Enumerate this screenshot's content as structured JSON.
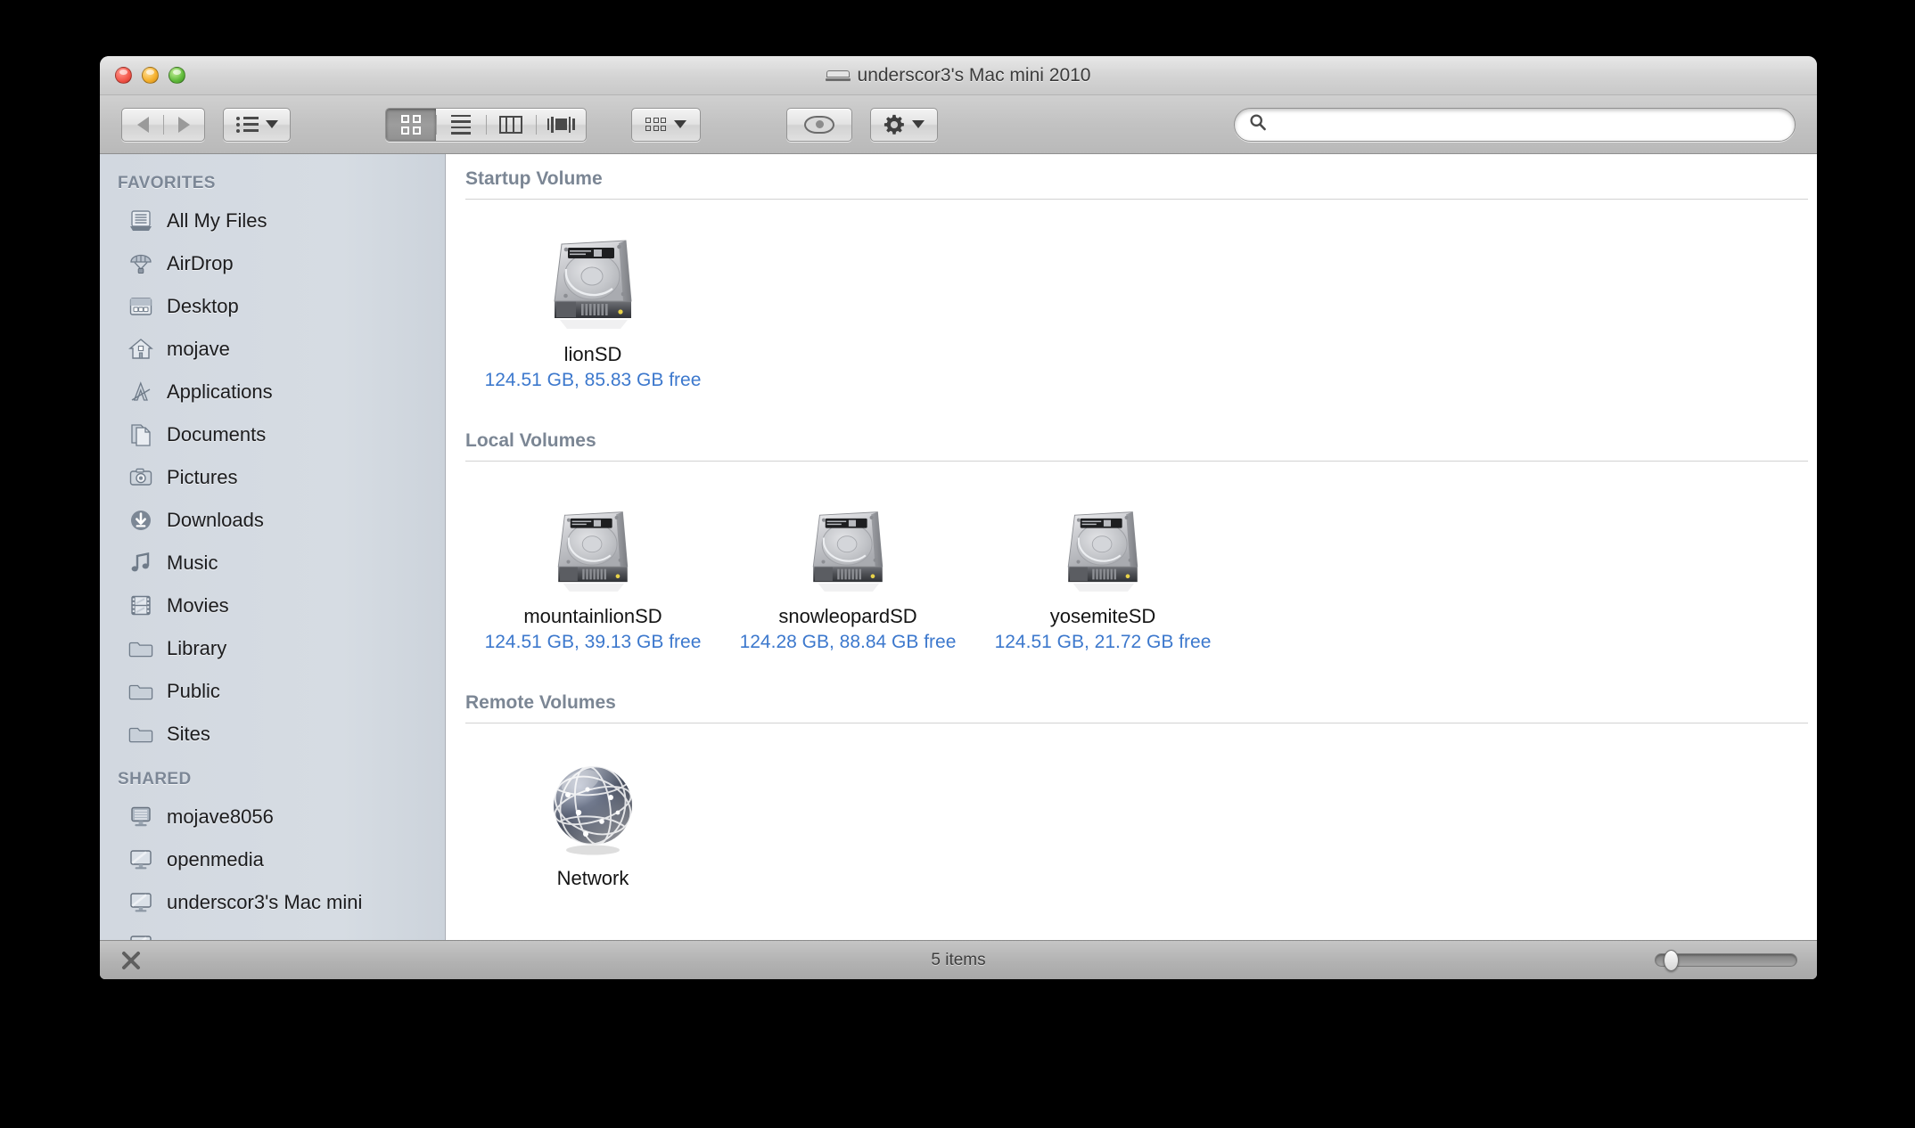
{
  "window": {
    "title": "underscor3's Mac mini 2010",
    "title_icon": "mac-mini-icon"
  },
  "traffic_lights": {
    "close_label": "close",
    "minimize_label": "minimize",
    "zoom_label": "zoom"
  },
  "toolbar": {
    "back_label": "Back",
    "forward_label": "Forward",
    "arrange_label": "Arrange",
    "view_icon_label": "Icon View",
    "view_list_label": "List View",
    "view_column_label": "Column View",
    "view_coverflow_label": "Cover Flow View",
    "view_selected": "Icon View",
    "group_label": "Group By",
    "quicklook_label": "Quick Look",
    "action_label": "Action"
  },
  "search": {
    "value": "",
    "placeholder": "",
    "icon": "search-icon"
  },
  "sidebar": {
    "sections": [
      {
        "header": "FAVORITES",
        "items": [
          {
            "label": "All My Files",
            "icon": "all-my-files-icon"
          },
          {
            "label": "AirDrop",
            "icon": "airdrop-icon"
          },
          {
            "label": "Desktop",
            "icon": "desktop-icon"
          },
          {
            "label": "mojave",
            "icon": "home-icon"
          },
          {
            "label": "Applications",
            "icon": "applications-icon"
          },
          {
            "label": "Documents",
            "icon": "documents-icon"
          },
          {
            "label": "Pictures",
            "icon": "pictures-icon"
          },
          {
            "label": "Downloads",
            "icon": "downloads-icon"
          },
          {
            "label": "Music",
            "icon": "music-icon"
          },
          {
            "label": "Movies",
            "icon": "movies-icon"
          },
          {
            "label": "Library",
            "icon": "folder-icon"
          },
          {
            "label": "Public",
            "icon": "folder-icon"
          },
          {
            "label": "Sites",
            "icon": "folder-icon"
          }
        ]
      },
      {
        "header": "SHARED",
        "items": [
          {
            "label": "mojave8056",
            "icon": "shared-server-icon"
          },
          {
            "label": "openmedia",
            "icon": "shared-display-icon"
          },
          {
            "label": "underscor3's Mac mini",
            "icon": "shared-display-icon"
          }
        ]
      }
    ]
  },
  "content": {
    "groups": [
      {
        "header": "Startup Volume",
        "items": [
          {
            "name": "lionSD",
            "subtitle": "124.51 GB, 85.83 GB free",
            "icon": "hard-drive-icon"
          }
        ]
      },
      {
        "header": "Local Volumes",
        "items": [
          {
            "name": "mountainlionSD",
            "subtitle": "124.51 GB, 39.13 GB free",
            "icon": "hard-drive-icon"
          },
          {
            "name": "snowleopardSD",
            "subtitle": "124.28 GB, 88.84 GB free",
            "icon": "hard-drive-icon"
          },
          {
            "name": "yosemiteSD",
            "subtitle": "124.51 GB, 21.72 GB free",
            "icon": "hard-drive-icon"
          }
        ]
      },
      {
        "header": "Remote Volumes",
        "items": [
          {
            "name": "Network",
            "subtitle": "",
            "icon": "network-globe-icon"
          }
        ]
      }
    ]
  },
  "statusbar": {
    "item_count": "5 items",
    "hide_sidebar_icon": "close-x-icon",
    "zoom_slider_label": "Icon size"
  },
  "colors": {
    "link_blue": "#3c78cd",
    "group_header": "#7b8694",
    "sidebar_bg": "#d6dce3",
    "content_bg": "#ffffff"
  }
}
